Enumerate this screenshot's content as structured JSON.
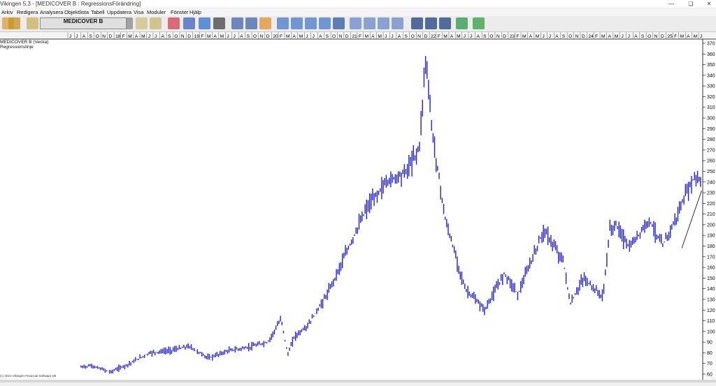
{
  "window": {
    "title": "Vikingen 5.3 - [MEDICOVER B : RegressionsFörändring]"
  },
  "menu": [
    "Arkiv",
    "Redigera",
    "Analysera",
    "Objektlista",
    "Tabell",
    "Uppdatera",
    "Visa",
    "Moduler",
    "Fönster",
    "Hjälp"
  ],
  "toolbar": {
    "symbol": "MEDICOVER B",
    "icons": [
      "open-folder-icon",
      "import-icon",
      "notes-icon",
      "stepper-icon",
      "list-icon",
      "edit-list-icon",
      "chart-lines-icon",
      "info-icon",
      "refresh-icon",
      "camera-icon",
      "printer-icon",
      "printer-icon",
      "palette-icon",
      "window-icon",
      "window-icon",
      "window-icon",
      "window-icon",
      "grid-icon",
      "window-icon",
      "window-icon",
      "window-icon",
      "window-icon",
      "candlestick-icon",
      "bars-icon",
      "curve-icon",
      "globe-icon",
      "update-icon"
    ]
  },
  "chart_labels": {
    "security": "MEDICOVER B (Vecka)",
    "indicator": "Regressionslinje",
    "copyright": "(c) 2021 Vikingen Financial Software AB"
  },
  "colors": {
    "price": "#1f1fdc",
    "regression": "#000000",
    "background": "#ffffff",
    "axis": "#000000"
  },
  "chart_data": {
    "type": "bar",
    "subtype": "weekly high-low bars",
    "y_ticks": [
      60,
      70,
      80,
      90,
      100,
      110,
      120,
      130,
      140,
      150,
      160,
      170,
      180,
      190,
      200,
      210,
      220,
      230,
      240,
      250,
      260,
      270,
      280,
      290,
      300,
      310,
      320,
      330,
      340,
      350,
      360,
      370
    ],
    "ylim": [
      55,
      373
    ],
    "y_axis_side": "right",
    "x_axis_side": "top",
    "x_axis_months": [
      "J",
      "J",
      "A",
      "S",
      "O",
      "N",
      "D",
      "18",
      "F",
      "M",
      "A",
      "M",
      "J",
      "J",
      "A",
      "S",
      "O",
      "N",
      "D",
      "19",
      "F",
      "M",
      "A",
      "M",
      "J",
      "J",
      "A",
      "S",
      "O",
      "N",
      "D",
      "20",
      "F",
      "M",
      "A",
      "M",
      "J",
      "J",
      "A",
      "S",
      "O",
      "N",
      "D",
      "21",
      "F",
      "M",
      "A",
      "M",
      "J",
      "J",
      "A",
      "S",
      "O",
      "N",
      "D",
      "22",
      "F",
      "M",
      "A",
      "M",
      "J",
      "J",
      "A",
      "S",
      "O",
      "N",
      "D",
      "23",
      "F",
      "M",
      "A",
      "M",
      "J",
      "J",
      "A",
      "S",
      "O",
      "N",
      "D",
      "24",
      "F",
      "M",
      "A",
      "M",
      "J",
      "J",
      "A",
      "S",
      "O",
      "N",
      "D",
      "25",
      "F",
      "M",
      "A",
      "M",
      "J"
    ],
    "x_range": [
      "2017-06",
      "2025-06"
    ],
    "series": [
      {
        "name": "MEDICOVER B",
        "x": [
          "2017-06",
          "2017-09",
          "2017-12",
          "2018-03",
          "2018-06",
          "2018-09",
          "2018-12",
          "2019-03",
          "2019-06",
          "2019-09",
          "2019-12",
          "2020-02",
          "2020-03",
          "2020-04",
          "2020-06",
          "2020-09",
          "2020-12",
          "2021-03",
          "2021-06",
          "2021-09",
          "2021-11",
          "2021-12",
          "2022-01",
          "2022-03",
          "2022-06",
          "2022-09",
          "2022-12",
          "2023-02",
          "2023-06",
          "2023-09",
          "2023-10",
          "2023-12",
          "2024-03",
          "2024-04",
          "2024-05",
          "2024-07",
          "2024-10",
          "2024-12",
          "2025-02",
          "2025-04",
          "2025-05",
          "2025-06"
        ],
        "values": [
          65,
          68,
          62,
          70,
          80,
          82,
          86,
          75,
          82,
          85,
          90,
          112,
          78,
          95,
          105,
          135,
          175,
          215,
          240,
          250,
          272,
          358,
          285,
          205,
          140,
          120,
          155,
          135,
          195,
          165,
          125,
          150,
          132,
          195,
          200,
          178,
          205,
          180,
          205,
          235,
          245,
          240
        ]
      },
      {
        "name": "Regressionslinje",
        "x": [
          "2025-03",
          "2025-06"
        ],
        "values": [
          178,
          232
        ]
      }
    ]
  }
}
